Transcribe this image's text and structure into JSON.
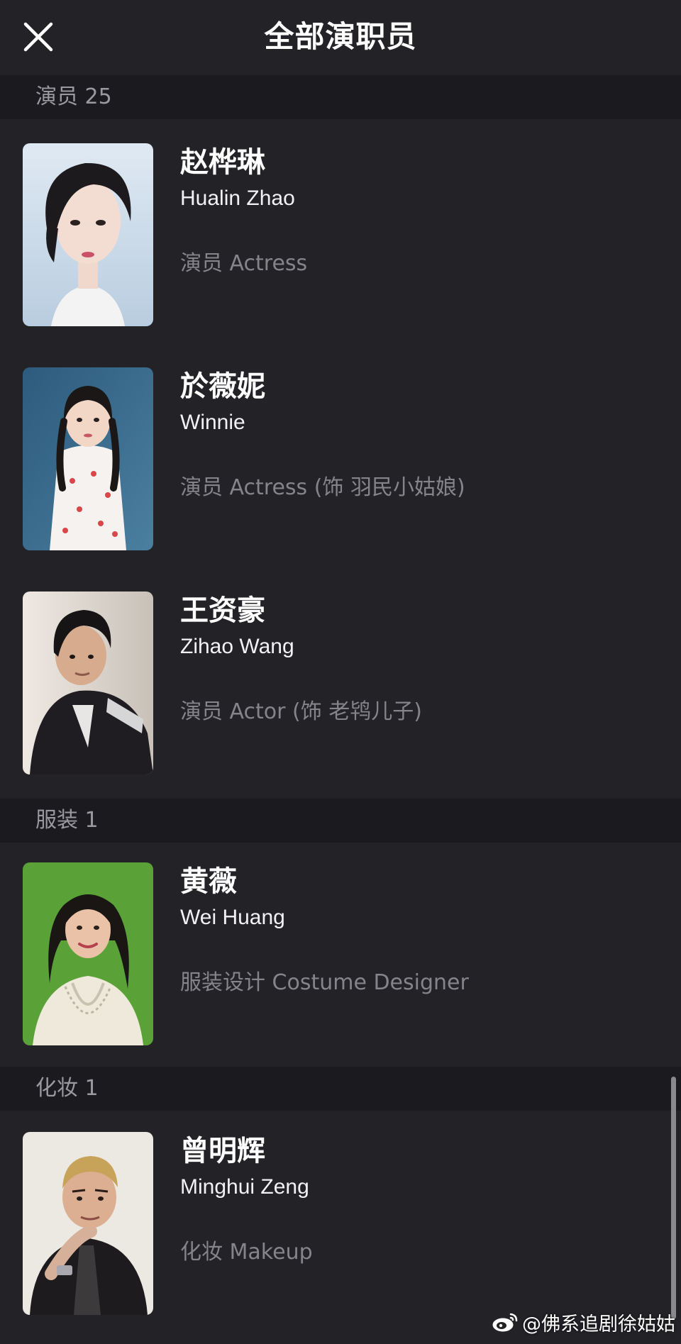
{
  "header": {
    "close_icon": "close-icon",
    "title": "全部演职员"
  },
  "sections": [
    {
      "label": "演员 25",
      "people": [
        {
          "name_zh": "赵桦琳",
          "name_en": "Hualin Zhao",
          "role": "演员 Actress"
        },
        {
          "name_zh": "於薇妮",
          "name_en": "Winnie",
          "role": "演员 Actress (饰 羽民小姑娘)"
        },
        {
          "name_zh": "王资豪",
          "name_en": "Zihao Wang",
          "role": "演员 Actor (饰 老鸨儿子)"
        }
      ]
    },
    {
      "label": "服装 1",
      "people": [
        {
          "name_zh": "黄薇",
          "name_en": "Wei Huang",
          "role": "服装设计 Costume Designer"
        }
      ]
    },
    {
      "label": "化妆 1",
      "people": [
        {
          "name_zh": "曾明辉",
          "name_en": "Minghui Zeng",
          "role": "化妆 Makeup"
        }
      ]
    }
  ],
  "watermark": {
    "icon": "weibo-icon",
    "text": "@佛系追剧徐姑姑"
  },
  "colors": {
    "background": "#232227",
    "section_background": "#1b1a1f",
    "section_label": "#9a999f",
    "role_text": "#85848a"
  }
}
